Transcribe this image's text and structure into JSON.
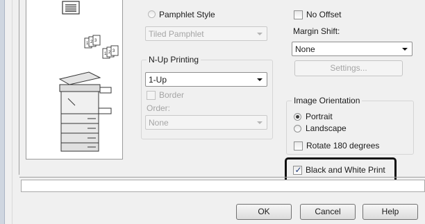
{
  "pamphlet": {
    "style_label": "Pamphlet Style",
    "style_value": "Tiled Pamphlet"
  },
  "nup": {
    "group_title": "N-Up Printing",
    "value": "1-Up",
    "border_label": "Border",
    "order_label": "Order:",
    "order_value": "None"
  },
  "margin": {
    "no_offset_label": "No Offset",
    "shift_label": "Margin Shift:",
    "shift_value": "None",
    "settings_label": "Settings..."
  },
  "orientation": {
    "group_title": "Image Orientation",
    "portrait_label": "Portrait",
    "landscape_label": "Landscape",
    "rotate_label": "Rotate 180 degrees"
  },
  "bw_print": {
    "label": "Black and White Print",
    "checked": true
  },
  "buttons": {
    "ok": "OK",
    "cancel": "Cancel",
    "help": "Help"
  }
}
